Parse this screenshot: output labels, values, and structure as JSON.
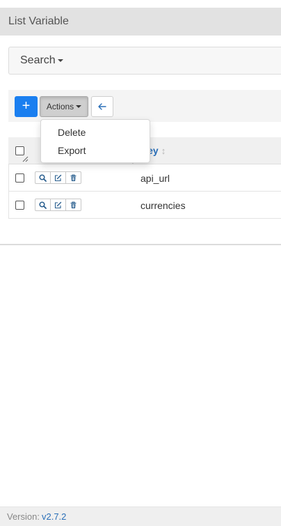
{
  "header": {
    "title": "List Variable"
  },
  "search": {
    "label": "Search"
  },
  "toolbar": {
    "add_label": "+",
    "actions_label": "Actions",
    "icons": {
      "add": "plus-icon",
      "back": "arrow-left-icon"
    }
  },
  "actions_menu": {
    "items": [
      "Delete",
      "Export"
    ]
  },
  "table": {
    "columns": {
      "key": "Key"
    },
    "row_icons": [
      "search-icon",
      "edit-icon",
      "trash-icon"
    ],
    "rows": [
      {
        "key": "api_url"
      },
      {
        "key": "currencies"
      }
    ]
  },
  "footer": {
    "version_label": "Version:",
    "version": "v2.7.2"
  },
  "colors": {
    "accent": "#1a7ff0",
    "link": "#2a6fb8",
    "title_bar": "#e2e2e2"
  }
}
